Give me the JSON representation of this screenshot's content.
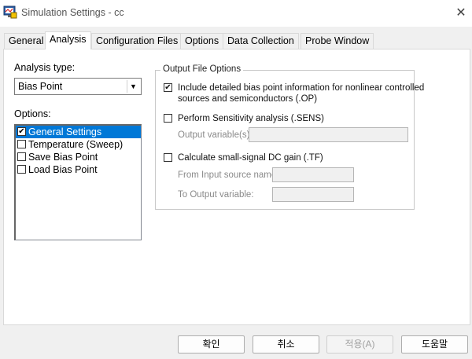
{
  "window": {
    "title": "Simulation Settings - cc",
    "close_symbol": "✕",
    "app_icon": "simulation-app-icon"
  },
  "tabs": [
    {
      "label": "General",
      "active": false
    },
    {
      "label": "Analysis",
      "active": true
    },
    {
      "label": "Configuration Files",
      "active": false
    },
    {
      "label": "Options",
      "active": false
    },
    {
      "label": "Data Collection",
      "active": false
    },
    {
      "label": "Probe Window",
      "active": false
    }
  ],
  "analysis": {
    "analysis_type_label": "Analysis type:",
    "analysis_type_value": "Bias Point",
    "options_label": "Options:",
    "options": [
      {
        "label": "General Settings",
        "checked": true,
        "selected": true
      },
      {
        "label": "Temperature (Sweep)",
        "checked": false,
        "selected": false
      },
      {
        "label": "Save Bias Point",
        "checked": false,
        "selected": false
      },
      {
        "label": "Load Bias Point",
        "checked": false,
        "selected": false
      }
    ]
  },
  "output_file_options": {
    "title": "Output File Options",
    "include_detailed": {
      "checked": true,
      "line1": "Include detailed bias point information for nonlinear controlled",
      "line2": "sources and semiconductors (.OP)"
    },
    "sensitivity": {
      "checked": false,
      "label": "Perform Sensitivity analysis (.SENS)",
      "output_var_label": "Output variable(s):",
      "output_var_value": ""
    },
    "dc_gain": {
      "checked": false,
      "label": "Calculate small-signal DC gain (.TF)",
      "from_label": "From Input source name:",
      "from_value": "",
      "to_label": "To Output variable:",
      "to_value": ""
    }
  },
  "buttons": {
    "ok": "확인",
    "cancel": "취소",
    "apply": "적용(A)",
    "help": "도움말"
  },
  "colors": {
    "selection": "#0078d7",
    "disabled_text": "#8a8a8a"
  }
}
